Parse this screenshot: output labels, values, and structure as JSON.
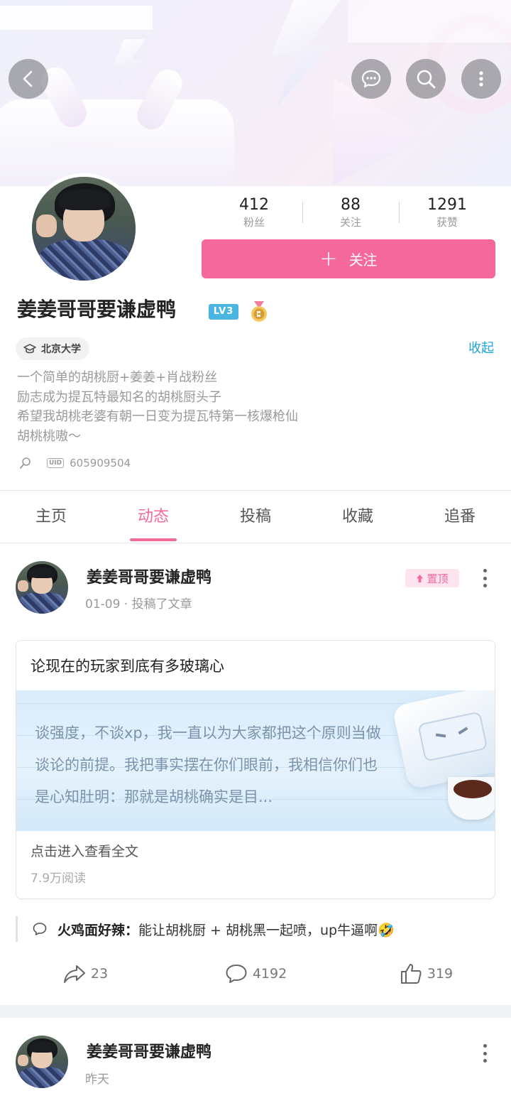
{
  "header": {
    "icons": {
      "back": "chevron-left-icon",
      "messages": "chat-bubble-icon",
      "search": "search-icon",
      "more": "more-vertical-icon"
    }
  },
  "profile": {
    "stats": [
      {
        "value": "412",
        "label": "粉丝"
      },
      {
        "value": "88",
        "label": "关注"
      },
      {
        "value": "1291",
        "label": "获赞"
      }
    ],
    "follow_plus": "+",
    "follow_label": "关注",
    "username": "姜姜哥哥要谦虚鸭",
    "level": "LV3",
    "school": "北京大学",
    "collapse_label": "收起",
    "bio_lines": [
      "一个简单的胡桃厨+姜姜+肖战粉丝",
      "励志成为提瓦特最知名的胡桃厨头子",
      "希望我胡桃老婆有朝一日变为提瓦特第一核爆枪仙",
      "胡桃桃嗷～"
    ],
    "uid_icon_text": "UID",
    "uid": "605909504"
  },
  "tabs": [
    {
      "label": "主页",
      "active": false
    },
    {
      "label": "动态",
      "active": true
    },
    {
      "label": "投稿",
      "active": false
    },
    {
      "label": "收藏",
      "active": false
    },
    {
      "label": "追番",
      "active": false
    }
  ],
  "posts": [
    {
      "author": "姜姜哥哥要谦虚鸭",
      "subtitle": "01-09 · 投稿了文章",
      "pin_label": "置顶",
      "article": {
        "title": "论现在的玩家到底有多玻璃心",
        "preview": "谈强度，不谈xp，我一直以为大家都把这个原则当做谈论的前提。我把事实摆在你们眼前，我相信你们也是心知肚明：那就是胡桃确实是目...",
        "read_full": "点击进入查看全文",
        "read_count": "7.9万阅读"
      },
      "top_comment": {
        "user": "火鸡面好辣：",
        "text": "能让胡桃厨 + 胡桃黑一起喷，up牛逼啊🤣"
      },
      "actions": {
        "share": "23",
        "comments": "4192",
        "likes": "319"
      }
    },
    {
      "author": "姜姜哥哥要谦虚鸭",
      "subtitle": "昨天"
    }
  ],
  "colors": {
    "accent": "#f5689b",
    "link": "#1ea3d6",
    "level_badge": "#49b5e0"
  }
}
